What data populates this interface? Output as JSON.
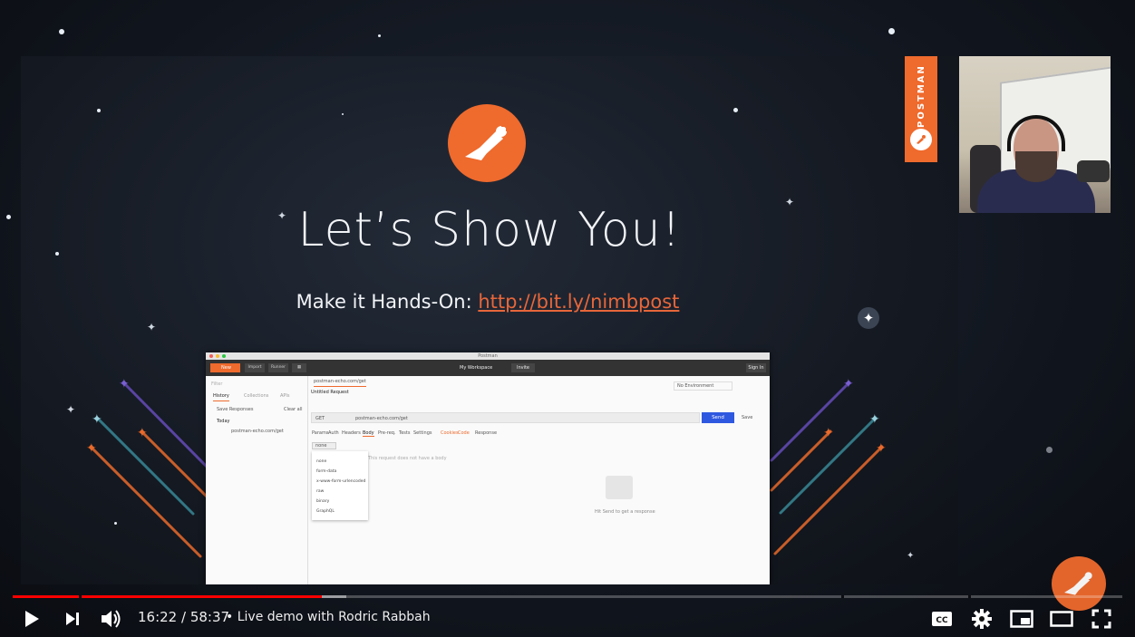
{
  "slide": {
    "title": "Let’s Show You!",
    "subtitle_prefix": "Make it Hands-On: ",
    "subtitle_link": "http://bit.ly/nimbpost",
    "brand_badge": "POSTMAN",
    "accent_color": "#ef6a2d"
  },
  "embedded_app": {
    "window_title": "Postman",
    "new_label": "New",
    "import_label": "Import",
    "runner_label": "Runner",
    "workspace_label": "My Workspace",
    "invite_label": "Invite",
    "signin_label": "Sign In",
    "filter_placeholder": "Filter",
    "tabs": [
      "History",
      "Collections",
      "APIs"
    ],
    "save_responses_label": "Save Responses",
    "clear_all_label": "Clear all",
    "today_label": "Today",
    "history_item": "postman-echo.com/get",
    "request_tab": "postman-echo.com/get",
    "untitled_request": "Untitled Request",
    "environment": "No Environment",
    "method": "GET",
    "url": "postman-echo.com/get",
    "send_label": "Send",
    "save_label": "Save",
    "request_tabs": [
      "Params",
      "Auth",
      "Headers",
      "Body",
      "Pre-req.",
      "Tests",
      "Settings"
    ],
    "cookies_label": "Cookies",
    "code_label": "Code",
    "response_label": "Response",
    "body_type": "none",
    "body_options": [
      "none",
      "form-data",
      "x-www-form-urlencoded",
      "raw",
      "binary",
      "GraphQL"
    ],
    "body_hint": "This request does not have a body",
    "response_hint": "Hit Send to get a response",
    "send_color": "#2f58e0"
  },
  "player": {
    "current_time": "16:22",
    "duration": "58:37",
    "time_separator": " / ",
    "chapter_bullet": "•",
    "chapter_title": "Live demo with Rodric Rabbah",
    "played_fraction": 0.279,
    "buffered_fraction": 0.301,
    "chapter_marks": [
      0.06,
      0.747,
      0.861
    ],
    "played_color": "#ff0000",
    "icons": {
      "play": "play-icon",
      "next": "next-icon",
      "volume": "volume-icon",
      "captions": "cc-icon",
      "settings": "gear-icon",
      "miniplayer": "miniplayer-icon",
      "theater": "theater-icon",
      "fullscreen": "fullscreen-icon"
    }
  }
}
